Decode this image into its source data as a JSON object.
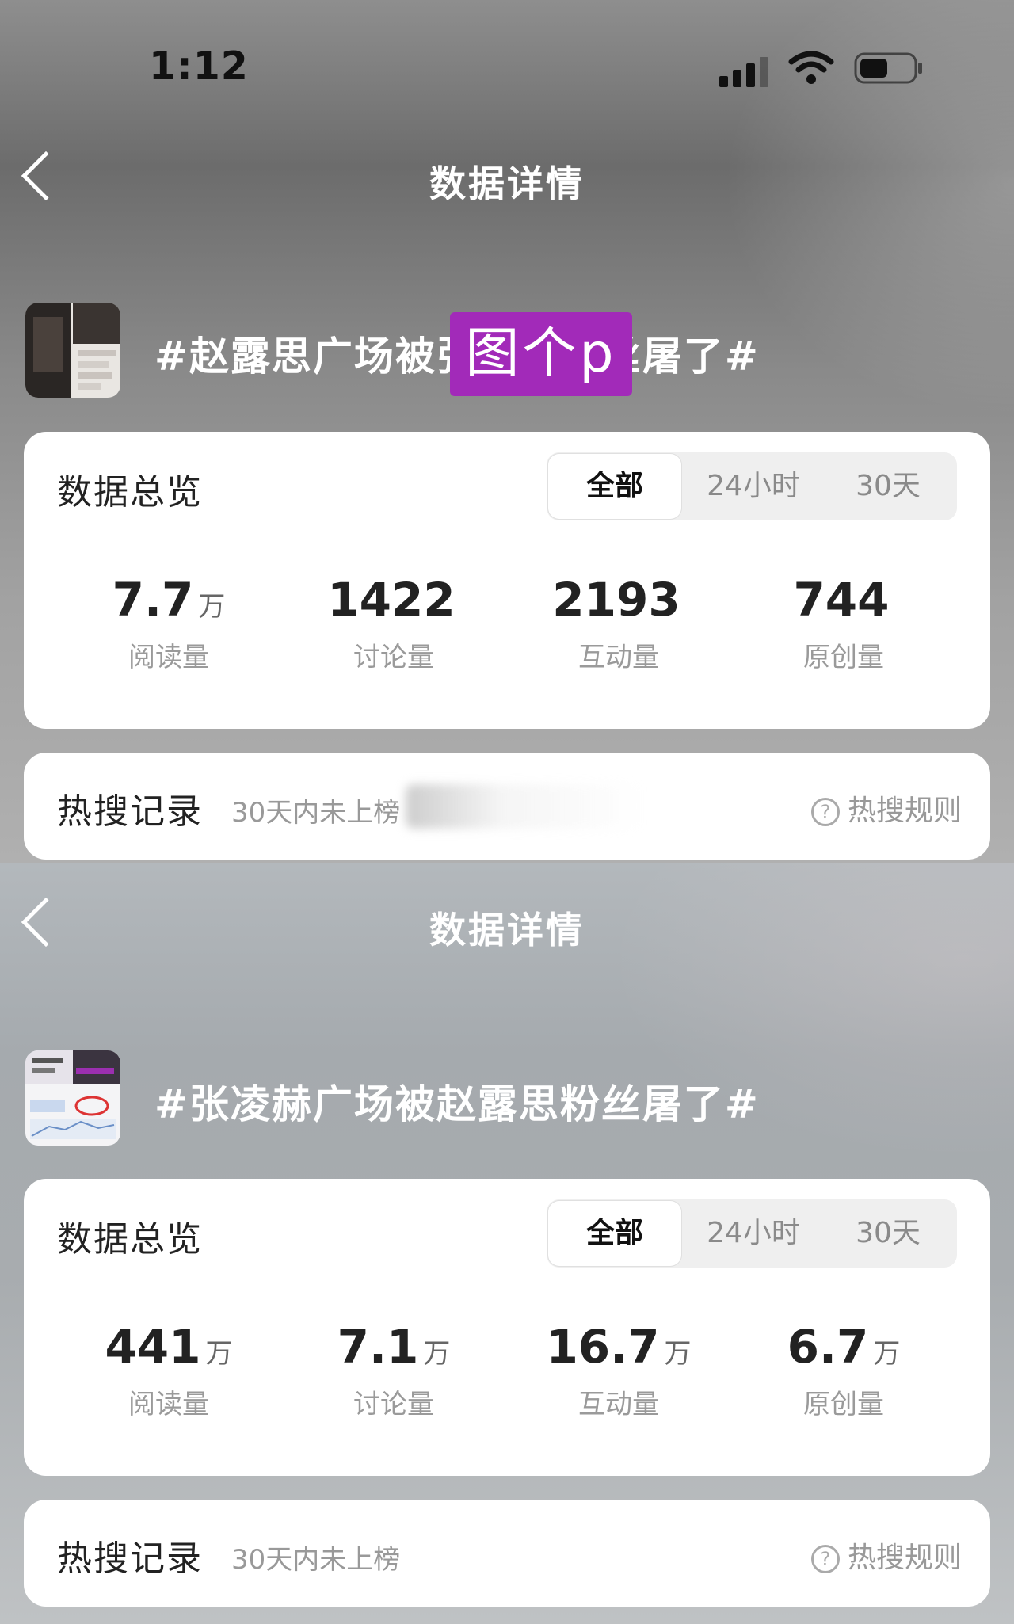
{
  "status_bar": {
    "time": "1:12"
  },
  "screens": [
    {
      "nav": {
        "title": "数据详情"
      },
      "topic": {
        "title": "#赵露思广场被张凌赫粉丝屠了#"
      },
      "overlay": "图个p",
      "overview": {
        "title": "数据总览",
        "tabs": [
          {
            "label": "全部",
            "active": true
          },
          {
            "label": "24小时",
            "active": false
          },
          {
            "label": "30天",
            "active": false
          }
        ],
        "stats": [
          {
            "value": "7.7",
            "unit": "万",
            "label": "阅读量"
          },
          {
            "value": "1422",
            "unit": "",
            "label": "讨论量"
          },
          {
            "value": "2193",
            "unit": "",
            "label": "互动量"
          },
          {
            "value": "744",
            "unit": "",
            "label": "原创量"
          }
        ]
      },
      "hot": {
        "title": "热搜记录",
        "status": "30天内未上榜",
        "rules": "热搜规则"
      }
    },
    {
      "nav": {
        "title": "数据详情"
      },
      "topic": {
        "title": "#张凌赫广场被赵露思粉丝屠了#"
      },
      "overview": {
        "title": "数据总览",
        "tabs": [
          {
            "label": "全部",
            "active": true
          },
          {
            "label": "24小时",
            "active": false
          },
          {
            "label": "30天",
            "active": false
          }
        ],
        "stats": [
          {
            "value": "441",
            "unit": "万",
            "label": "阅读量"
          },
          {
            "value": "7.1",
            "unit": "万",
            "label": "讨论量"
          },
          {
            "value": "16.7",
            "unit": "万",
            "label": "互动量"
          },
          {
            "value": "6.7",
            "unit": "万",
            "label": "原创量"
          }
        ]
      },
      "hot": {
        "title": "热搜记录",
        "status": "30天内未上榜",
        "rules": "热搜规则"
      }
    }
  ],
  "colors": {
    "overlay_purple": "#a22ab9",
    "card_bg": "#ffffff"
  }
}
